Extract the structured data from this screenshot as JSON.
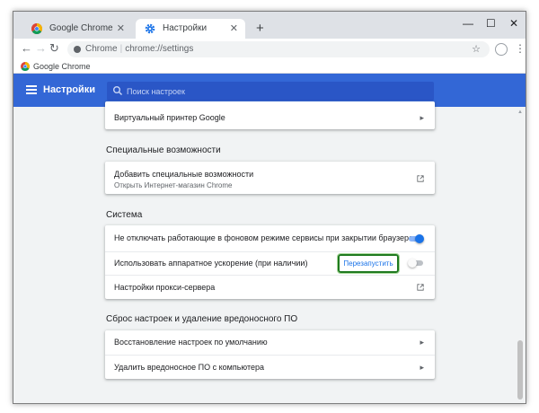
{
  "tabs": [
    {
      "title": "Google Chrome",
      "active": false
    },
    {
      "title": "Настройки",
      "active": true
    }
  ],
  "window_buttons": {
    "minimize": "—",
    "maximize": "☐",
    "close": "✕"
  },
  "omnibox": {
    "chip": "Chrome",
    "separator": "|",
    "url": "chrome://settings"
  },
  "bookmarks": [
    {
      "label": "Google Chrome"
    }
  ],
  "settings": {
    "title": "Настройки",
    "search_placeholder": "Поиск настроек"
  },
  "top_card": {
    "items": [
      {
        "label": "Виртуальный принтер Google"
      }
    ]
  },
  "sections": [
    {
      "title": "Специальные возможности",
      "items": [
        {
          "label": "Добавить специальные возможности",
          "sublabel": "Открыть Интернет-магазин Chrome"
        }
      ]
    },
    {
      "title": "Система",
      "items": [
        {
          "label": "Не отключать работающие в фоновом режиме сервисы при закрытии браузера",
          "toggle": "on"
        },
        {
          "label": "Использовать аппаратное ускорение (при наличии)",
          "button": "Перезапустить",
          "toggle": "off"
        },
        {
          "label": "Настройки прокси-сервера"
        }
      ]
    },
    {
      "title": "Сброс настроек и удаление вредоносного ПО",
      "items": [
        {
          "label": "Восстановление настроек по умолчанию"
        },
        {
          "label": "Удалить вредоносное ПО с компьютера"
        }
      ]
    }
  ],
  "colors": {
    "header": "#3367d6",
    "accent": "#1a73e8",
    "highlight_border": "#1f7a1f",
    "background": "#f1f3f4"
  },
  "icons": [
    "chrome-logo-icon",
    "settings-gear-icon",
    "close-icon",
    "new-tab-icon",
    "back-arrow-icon",
    "forward-arrow-icon",
    "reload-icon",
    "info-icon",
    "star-icon",
    "profile-icon",
    "menu-dots-icon",
    "hamburger-icon",
    "search-icon",
    "chevron-right-icon",
    "external-link-icon"
  ]
}
